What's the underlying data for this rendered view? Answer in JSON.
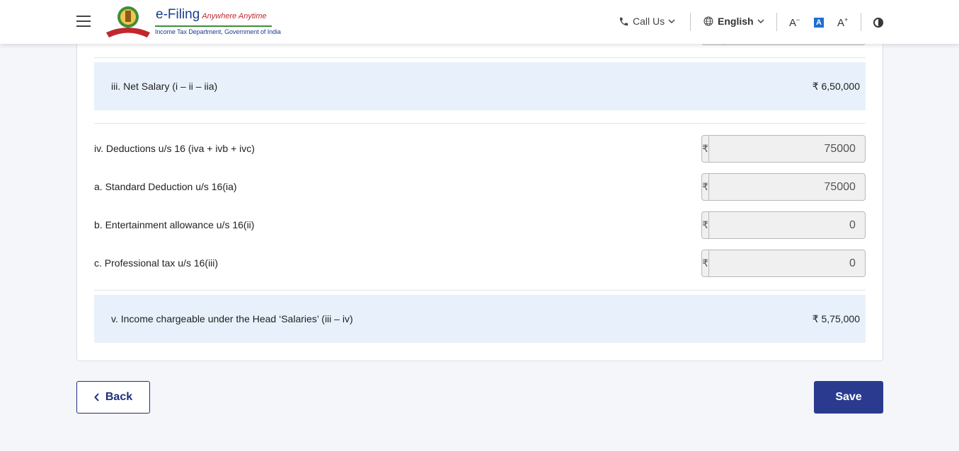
{
  "header": {
    "logo_title": "e-Filing",
    "logo_tagline": "Anywhere Anytime",
    "logo_subtitle": "Income Tax Department, Government of India",
    "call_label": "Call Us",
    "language_label": "English",
    "font_decrease": "A",
    "font_normal": "A",
    "font_increase": "A",
    "icons": [
      "menu-icon",
      "phone-icon",
      "globe-icon",
      "chevron-down-icon",
      "contrast-icon"
    ]
  },
  "form": {
    "net_salary": {
      "label": "iii. Net Salary (i – ii – iia)",
      "value": "₹ 6,50,000"
    },
    "deductions_total": {
      "label": "iv. Deductions u/s 16 (iva + ivb + ivc)",
      "currency": "₹",
      "value": "75000"
    },
    "standard_deduction": {
      "label": "a. Standard Deduction u/s 16(ia)",
      "currency": "₹",
      "value": "75000"
    },
    "entertainment_allowance": {
      "label": "b. Entertainment allowance u/s 16(ii)",
      "currency": "₹",
      "value": "0"
    },
    "professional_tax": {
      "label": "c. Professional tax u/s 16(iii)",
      "currency": "₹",
      "value": "0"
    },
    "income_chargeable": {
      "label": "v. Income chargeable under the Head ‘Salaries’ (iii – iv)",
      "value": "₹ 5,75,000"
    }
  },
  "buttons": {
    "back": "Back",
    "save": "Save"
  },
  "colors": {
    "primary": "#2a3b8f",
    "summary_bg": "#e8f1fb",
    "page_bg": "#f4f6fa"
  }
}
